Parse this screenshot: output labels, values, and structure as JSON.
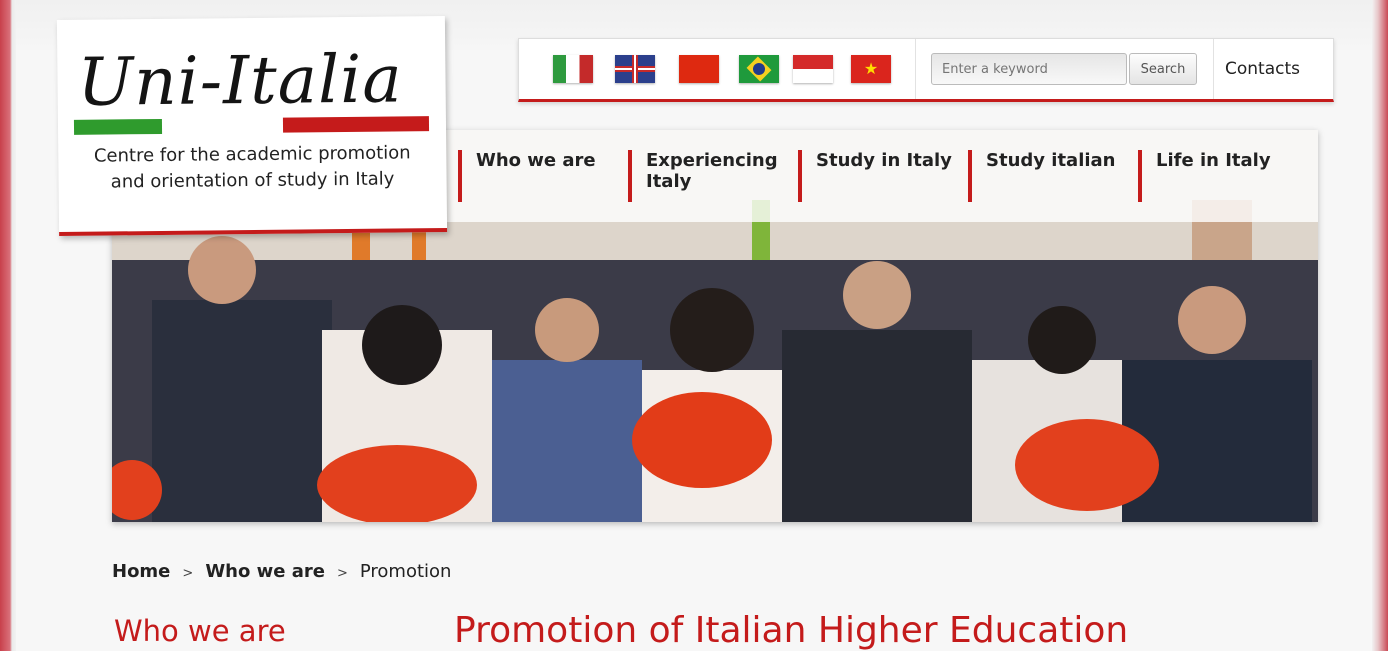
{
  "logo": {
    "wordmark": "Uni-Italia",
    "tagline_line1": "Centre for the academic promotion",
    "tagline_line2": "and orientation of study in Italy"
  },
  "toolbar": {
    "flags": [
      {
        "name": "italian-flag-icon"
      },
      {
        "name": "uk-flag-icon"
      },
      {
        "name": "china-flag-icon"
      },
      {
        "name": "brazil-flag-icon"
      },
      {
        "name": "indonesia-flag-icon"
      },
      {
        "name": "vietnam-flag-icon"
      }
    ],
    "search_placeholder": "Enter a keyword",
    "search_label": "Search",
    "contacts_label": "Contacts"
  },
  "nav": {
    "items": [
      {
        "label": "Who we are"
      },
      {
        "label": "Experiencing Italy"
      },
      {
        "label": "Study in Italy"
      },
      {
        "label": "Study italian"
      },
      {
        "label": "Life in Italy"
      }
    ]
  },
  "breadcrumb": {
    "home": "Home",
    "section": "Who we are",
    "current": "Promotion",
    "separator": ">"
  },
  "sidebar": {
    "title": "Who we are"
  },
  "main": {
    "title": "Promotion of Italian Higher Education"
  },
  "colors": {
    "accent": "#c41b1b",
    "green": "#2f9b2d"
  }
}
